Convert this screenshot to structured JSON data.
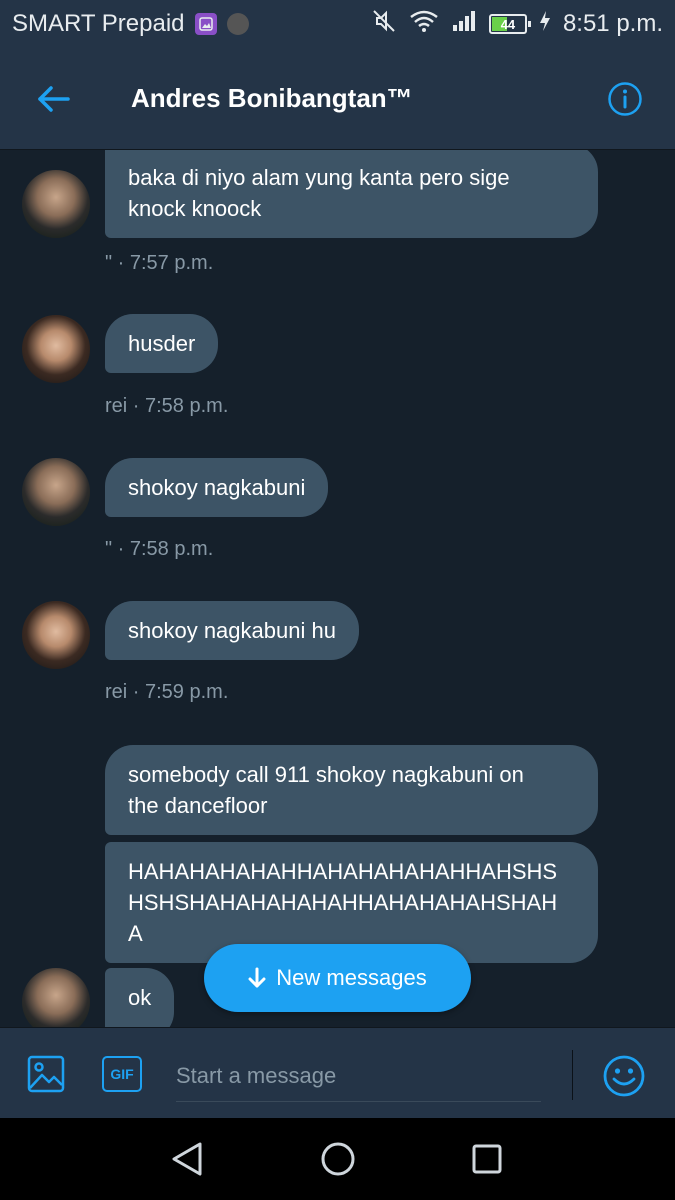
{
  "status_bar": {
    "carrier": "SMART Prepaid",
    "battery_level": "44",
    "time": "8:51 p.m."
  },
  "header": {
    "title": "Andres Bonibangtan™"
  },
  "messages": [
    {
      "text_line1": "baka di niyo alam yung kanta pero sige",
      "text_line2": "knock knoock",
      "meta": "\" · 7:57 p.m."
    },
    {
      "text": "husder",
      "meta": "rei · 7:58 p.m."
    },
    {
      "text": "shokoy nagkabuni",
      "meta": "\" · 7:58 p.m."
    },
    {
      "text": "shokoy nagkabuni hu",
      "meta": "rei · 7:59 p.m."
    },
    {
      "text_line1": "somebody call 911 shokoy nagkabuni on",
      "text_line2": "the dancefloor"
    },
    {
      "text_line1": "HAHAHAHAHAHHAHAHAHAHAHHAHSHS",
      "text_line2": "HSHSHAHAHAHAHAHHAHAHAHAHSHAH",
      "text_line3": "A"
    },
    {
      "text": "ok"
    }
  ],
  "new_messages_button": {
    "label": "New messages"
  },
  "composer": {
    "placeholder": "Start a message",
    "gif_label": "GIF"
  },
  "colors": {
    "background": "#15202b",
    "bar": "#243447",
    "bubble": "#3d5466",
    "accent": "#1da1f2",
    "meta_text": "#8899a6"
  }
}
